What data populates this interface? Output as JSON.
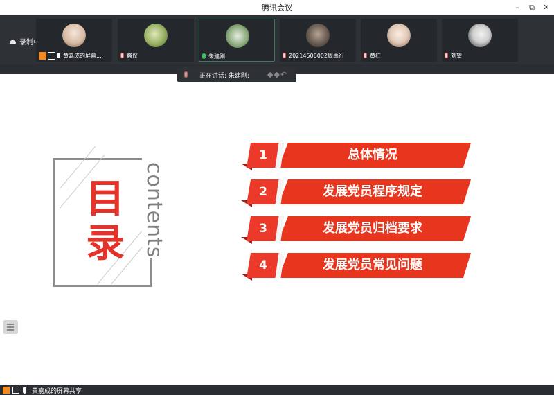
{
  "window": {
    "title": "腾讯会议"
  },
  "recording": {
    "label": "录制中"
  },
  "participants": [
    {
      "name": "黄嘉成的屏幕...",
      "mic": "on",
      "sharing": true,
      "avatar_color": "#e8d6c8"
    },
    {
      "name": "裔仪",
      "mic": "off",
      "sharing": false,
      "avatar_color": "#9db56a"
    },
    {
      "name": "朱建刚",
      "mic": "on",
      "sharing": false,
      "avatar_color": "#6e8b63"
    },
    {
      "name": "20214506002周禹行",
      "mic": "off",
      "sharing": false,
      "avatar_color": "#6a5c52"
    },
    {
      "name": "黄红",
      "mic": "off",
      "sharing": false,
      "avatar_color": "#e2c9b8"
    },
    {
      "name": "刘望",
      "mic": "off",
      "sharing": false,
      "avatar_color": "#cfcfcf"
    }
  ],
  "speaking": {
    "label": "正在讲话: 朱建刚;"
  },
  "slide": {
    "title_chars": [
      "目",
      "录"
    ],
    "subtitle": "contents",
    "items": [
      {
        "num": "1",
        "text": "总体情况"
      },
      {
        "num": "2",
        "text": "发展党员程序规定"
      },
      {
        "num": "3",
        "text": "发展党员归档要求"
      },
      {
        "num": "4",
        "text": "发展党员常见问题"
      }
    ]
  },
  "footer": {
    "share_label": "黄嘉成的屏幕共享"
  },
  "colors": {
    "accent_red": "#e8361e",
    "dark_red": "#a51e16",
    "strip_bg": "#2e3237"
  }
}
